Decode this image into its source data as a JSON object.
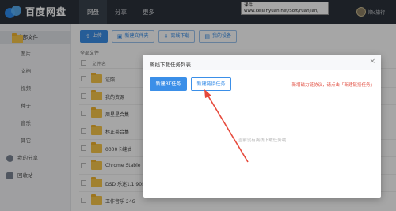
{
  "app": {
    "name": "百度网盘"
  },
  "topnav": [
    {
      "label": "网盘",
      "active": true
    },
    {
      "label": "分享",
      "active": false
    },
    {
      "label": "更多",
      "active": false
    }
  ],
  "url_tooltip": {
    "line1": "课件",
    "line2": "www.kejianyuan.net/Soft/ruanjian/"
  },
  "user": {
    "name": "顺c旅行"
  },
  "sidebar": {
    "items": [
      {
        "label": "全部文件",
        "type": "main",
        "icon": "folder-icon",
        "active": true
      },
      {
        "label": "图片",
        "type": "sub"
      },
      {
        "label": "文档",
        "type": "sub"
      },
      {
        "label": "视频",
        "type": "sub"
      },
      {
        "label": "种子",
        "type": "sub"
      },
      {
        "label": "音乐",
        "type": "sub"
      },
      {
        "label": "其它",
        "type": "sub"
      },
      {
        "label": "我的分享",
        "type": "main",
        "icon": "share-icon"
      },
      {
        "label": "回收站",
        "type": "main",
        "icon": "trash-icon"
      }
    ]
  },
  "toolbar": {
    "upload": "上传",
    "new_folder": "新建文件夹",
    "offline_download": "离线下载",
    "my_devices": "我的设备"
  },
  "file_list": {
    "breadcrumb": "全部文件",
    "column_name": "文件名",
    "rows": [
      "证照",
      "我的资源",
      "周星星合集",
      "林正英合集",
      "0000卡缝油",
      "Chrome Stable",
      "DSD 乐迷1.1 90载",
      "工作音乐 24G"
    ]
  },
  "dialog": {
    "title": "离线下载任务列表",
    "close": "×",
    "btn_bt": "新建BT任务",
    "btn_link": "新建链接任务",
    "notice": "新增磁力链协议，请点击「新建链接任务」",
    "empty": "当前没有离线下载任务哦"
  },
  "colors": {
    "topbar": "#2c323b",
    "accent": "#3b8fe8",
    "notice": "#e0483a",
    "arrow": "#e64a3c",
    "folder": "#f8c74a"
  }
}
